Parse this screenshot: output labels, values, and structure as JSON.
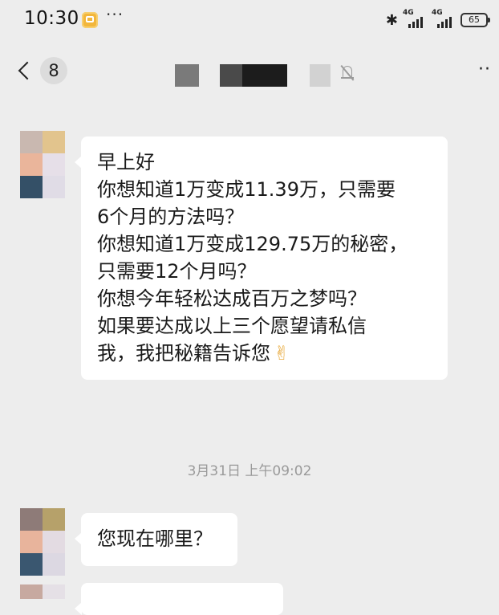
{
  "status_bar": {
    "time": "10:30",
    "more": "···",
    "bluetooth_icon": "✱",
    "signal_1_label": "4G",
    "signal_2_label": "4G",
    "battery": "65"
  },
  "nav": {
    "unread_count": "8",
    "menu": "··"
  },
  "messages": [
    {
      "lines": [
        "早上好",
        "你想知道1万变成11.39万，只需要",
        "6个月的方法吗？",
        "你想知道1万变成129.75万的秘密，",
        "只需要12个月吗？",
        "你想今年轻松达成百万之梦吗？",
        "如果要达成以上三个愿望请私信",
        "我，我把秘籍告诉您"
      ],
      "emoji": "✌"
    },
    {
      "text": "您现在哪里？"
    }
  ],
  "timestamp": "3月31日 上午09:02",
  "colors": {
    "background": "#ededed",
    "bubble": "#ffffff",
    "timestamp_text": "#9a9a9a",
    "app_badge": "#f2b63b"
  },
  "icons": {
    "back": "chevron-left-icon",
    "mute": "bell-off-icon",
    "menu": "more-horizontal-icon"
  }
}
